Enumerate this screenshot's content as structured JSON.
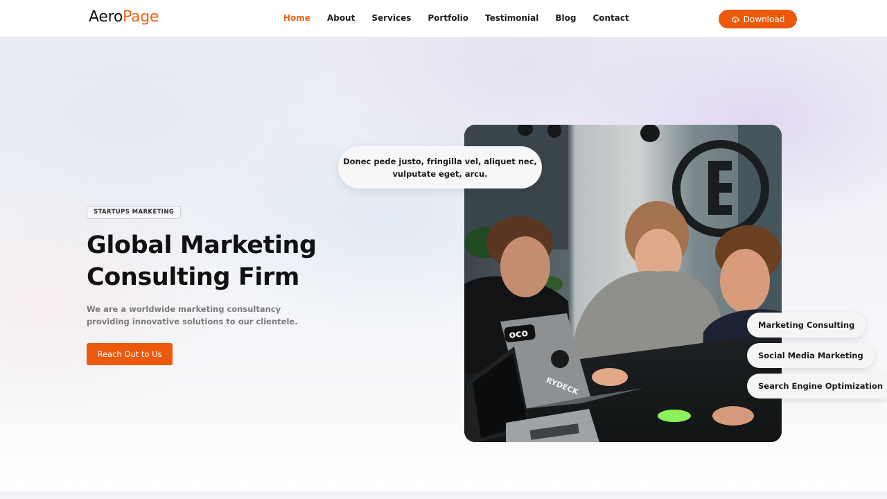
{
  "header": {
    "logo_part1": "Aero",
    "logo_part2": "Page",
    "nav": [
      {
        "label": "Home",
        "active": true
      },
      {
        "label": "About",
        "active": false
      },
      {
        "label": "Services",
        "active": false
      },
      {
        "label": "Portfolio",
        "active": false
      },
      {
        "label": "Testimonial",
        "active": false
      },
      {
        "label": "Blog",
        "active": false
      },
      {
        "label": "Contact",
        "active": false
      }
    ],
    "download_label": "Download"
  },
  "hero": {
    "tag": "STARTUPS MARKETING",
    "title_line1": "Global Marketing",
    "title_line2": "Consulting Firm",
    "description": "We are a worldwide marketing consultancy providing innovative solutions to our clientele.",
    "cta_label": "Reach Out to Us",
    "bubble_text": "Donec pede justo, fringilla vel, aliquet nec, vulputate eget, arcu.",
    "services": [
      "Marketing Consulting",
      "Social Media Marketing",
      "Search Engine Optimization"
    ],
    "laptop_sticker_text": "RYDECK"
  },
  "colors": {
    "accent": "#eb5a0c",
    "text_dark": "#121212",
    "text_muted": "#7a7a7a"
  },
  "icons": {
    "download": "cloud-download-icon"
  }
}
